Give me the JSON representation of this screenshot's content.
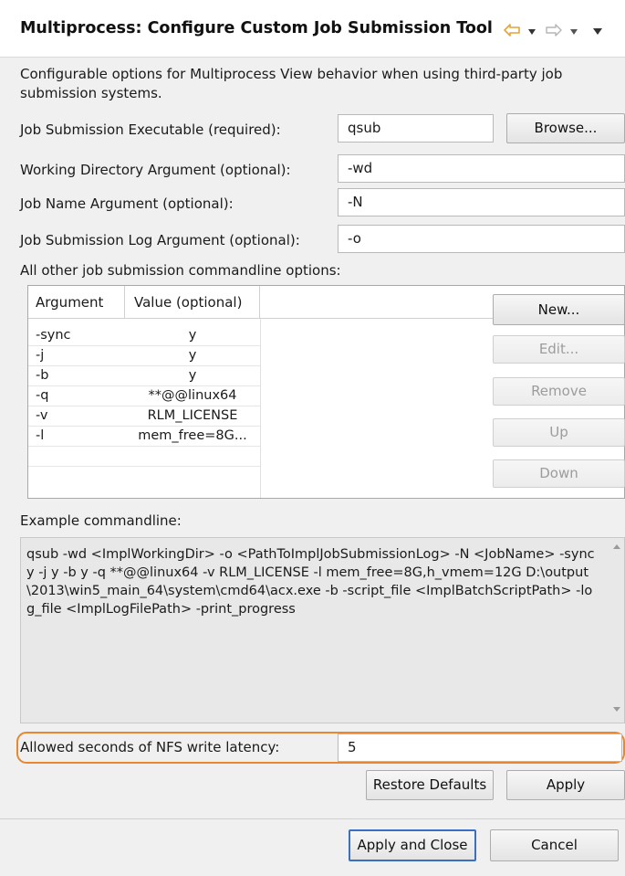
{
  "header": {
    "title": "Multiprocess: Configure Custom Job Submission Tool",
    "back_icon": "back-arrow-icon",
    "forward_icon": "forward-arrow-icon",
    "menu_icon": "view-menu-icon"
  },
  "description": "Configurable options for Multiprocess View behavior when using third-party job submission systems.",
  "fields": {
    "executable_label": "Job Submission Executable (required):",
    "executable_value": "qsub",
    "browse_label": "Browse...",
    "workdir_label": "Working Directory Argument (optional):",
    "workdir_value": "-wd",
    "jobname_label": "Job Name Argument (optional):",
    "jobname_value": "-N",
    "log_label": "Job Submission Log Argument (optional):",
    "log_value": "-o"
  },
  "options_label": "All other job submission commandline options:",
  "table": {
    "columns": [
      "Argument",
      "Value (optional)"
    ],
    "rows": [
      {
        "arg": "-sync",
        "val": "y"
      },
      {
        "arg": "-j",
        "val": "y"
      },
      {
        "arg": "-b",
        "val": "y"
      },
      {
        "arg": "-q",
        "val": "**@@linux64"
      },
      {
        "arg": "-v",
        "val": "RLM_LICENSE"
      },
      {
        "arg": "-l",
        "val": "mem_free=8G..."
      }
    ]
  },
  "side_buttons": {
    "new": "New...",
    "edit": "Edit...",
    "remove": "Remove",
    "up": "Up",
    "down": "Down"
  },
  "example_label": "Example commandline:",
  "example_text": "qsub -wd <ImplWorkingDir> -o <PathToImplJobSubmissionLog> -N <JobName> -sync y -j y -b y -q **@@linux64 -v RLM_LICENSE -l mem_free=8G,h_vmem=12G D:\\output\\2013\\win5_main_64\\system\\cmd64\\acx.exe -b -script_file <ImplBatchScriptPath> -log_file <ImplLogFilePath> -print_progress",
  "nfs": {
    "label": "Allowed seconds of NFS write latency:",
    "value": "5"
  },
  "bottom_buttons": {
    "restore": "Restore Defaults",
    "apply": "Apply",
    "apply_close": "Apply and Close",
    "cancel": "Cancel"
  },
  "colors": {
    "highlight_outline": "#e8872d",
    "back_arrow": "#e6a33a",
    "default_button_border": "#3b6fc4"
  }
}
